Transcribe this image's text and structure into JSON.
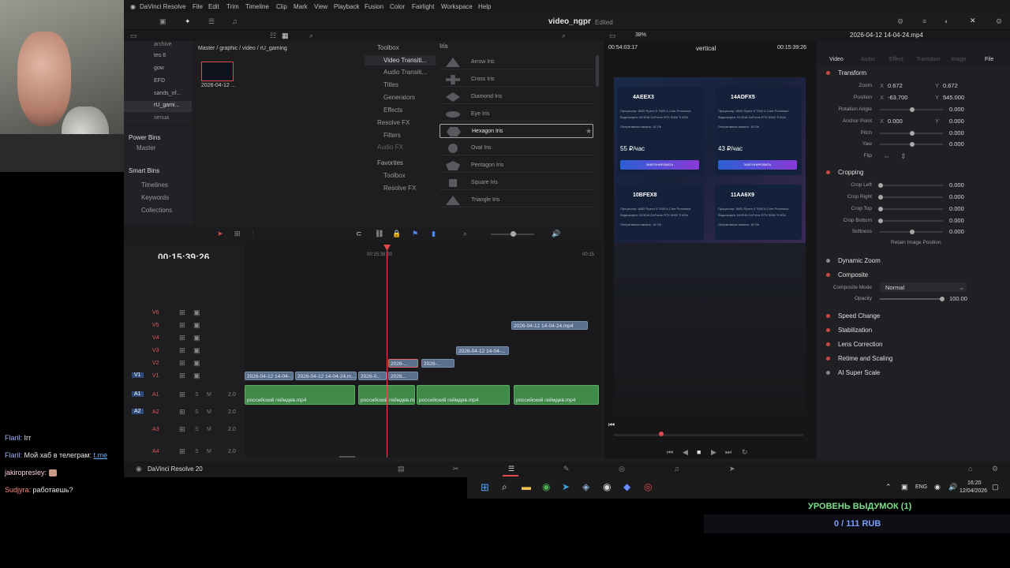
{
  "app": {
    "menus": [
      "DaVinci Resolve",
      "File",
      "Edit",
      "Trim",
      "Timeline",
      "Clip",
      "Mark",
      "View",
      "Playback",
      "Fusion",
      "Color",
      "Fairlight",
      "Workspace",
      "Help"
    ],
    "project": "video_ngpr",
    "project_status": "Edited",
    "zoom": "38%",
    "clip_name": "2026-04-12 14-04-24.mp4",
    "footer": "DaVinci Resolve 20"
  },
  "media": {
    "bins": [
      "archive",
      "tes 6",
      "gow",
      "EFD",
      "sands_of...",
      "rU_gami...",
      "senua"
    ],
    "path": "Master / graphic / video / rU_gaming",
    "power_bins": "Power Bins",
    "master": "Master",
    "smart_bins": "Smart Bins",
    "smart_items": [
      "Timelines",
      "Keywords",
      "Collections"
    ],
    "thumb_label": "2026-04-12 ..."
  },
  "effects": {
    "toolbox": "Toolbox",
    "items": [
      "Video Transiti...",
      "Audio Transiti...",
      "Titles",
      "Generators",
      "Effects"
    ],
    "openfx": "Resolve FX",
    "filters": "Filters",
    "audiofx": "Audio FX",
    "favorites": "Favorites",
    "fav_items": [
      "Toolbox",
      "Resolve FX"
    ],
    "section": "Iris",
    "iris": [
      "Arrow Iris",
      "Cross Iris",
      "Diamond Iris",
      "Eye Iris",
      "Hexagon Iris",
      "Oval Iris",
      "Pentagon Iris",
      "Square Iris",
      "Triangle Iris"
    ]
  },
  "viewer": {
    "timecode_left": "00:54:03:17",
    "mode": "vertical",
    "timecode_right": "00:15:39:26"
  },
  "timeline": {
    "timecode": "00:15:39:26",
    "ruler": [
      "00:15:38:00",
      "00:15"
    ],
    "video_tracks": [
      "V6",
      "V5",
      "V4",
      "V3",
      "V2",
      "V1"
    ],
    "audio_tracks": [
      "A1",
      "A2",
      "A3",
      "A4"
    ],
    "audio_vol": "2.0",
    "clips": {
      "v5": "2026-04-12 14-04-24.mp4",
      "v3": "2026-04-12 14-04-...",
      "v2a": "2026-...",
      "v2b": "2026-...",
      "v1a": "2026-04-12 14-04-...",
      "v1b": "2026-04-12 14-04-24.m...",
      "v1c": "2026-0...",
      "v1d": "2026...",
      "a1": "российский геймдев.mp4"
    }
  },
  "preview": {
    "cards": [
      {
        "id": "4AEEX3",
        "price": "55 ₽/час"
      },
      {
        "id": "14ADFX5",
        "price": "43 ₽/час"
      },
      {
        "id": "10BFEX8",
        "price": ""
      },
      {
        "id": "11AA6X9",
        "price": ""
      }
    ],
    "cpu": "Процессор: AMD Ryzen 5 7600 6-Core Processor",
    "gpu": "Видеокарта: NVIDIA GeForce RTX 5060 Ti 8Gb",
    "ram": "Оперативная память: 16 Gb",
    "btn": "ЗАБРОНИРОВАТЬ"
  },
  "inspector": {
    "tabs": [
      "Video",
      "Audio",
      "Effect",
      "Transition",
      "Image",
      "File"
    ],
    "transform": "Transform",
    "zoom_x": "0.672",
    "zoom_y": "0.672",
    "pos_x": "-63.700",
    "pos_y": "545.000",
    "rotation": "0.000",
    "anchor_x": "0.000",
    "anchor_y": "0.000",
    "pitch": "0.000",
    "yaw": "0.000",
    "labels": {
      "zoom": "Zoom",
      "position": "Position",
      "rotation": "Rotation Angle",
      "anchor": "Anchor Point",
      "pitch": "Pitch",
      "yaw": "Yaw",
      "flip": "Flip"
    },
    "cropping": "Cropping",
    "crop_labels": [
      "Crop Left",
      "Crop Right",
      "Crop Top",
      "Crop Bottom",
      "Softness"
    ],
    "crop_vals": [
      "0.000",
      "0.000",
      "0.000",
      "0.000",
      "0.000"
    ],
    "retain": "Retain Image Position",
    "dynamic_zoom": "Dynamic Zoom",
    "composite": "Composite",
    "composite_mode_label": "Composite Mode",
    "composite_mode": "Normal",
    "opacity_label": "Opacity",
    "opacity": "100.00",
    "sections": [
      "Speed Change",
      "Stabilization",
      "Lens Correction",
      "Retime and Scaling",
      "AI Super Scale"
    ]
  },
  "chat": [
    {
      "nick": "Flaril:",
      "msg": "Ігг"
    },
    {
      "nick": "Flaril:",
      "msg": "Мой хаб в телеграм: ",
      "link": "t.me"
    },
    {
      "nick": "jakiropresley:",
      "msg": ""
    },
    {
      "nick": "Sudjyra:",
      "msg": "работаешь?"
    }
  ],
  "tray": {
    "lang": "ENG",
    "time": "16:20",
    "date": "12/04/2026"
  },
  "widget": {
    "title": "УРОВЕНЬ ВЫДУМОК (1)",
    "value": "0 / 111 RUB"
  }
}
